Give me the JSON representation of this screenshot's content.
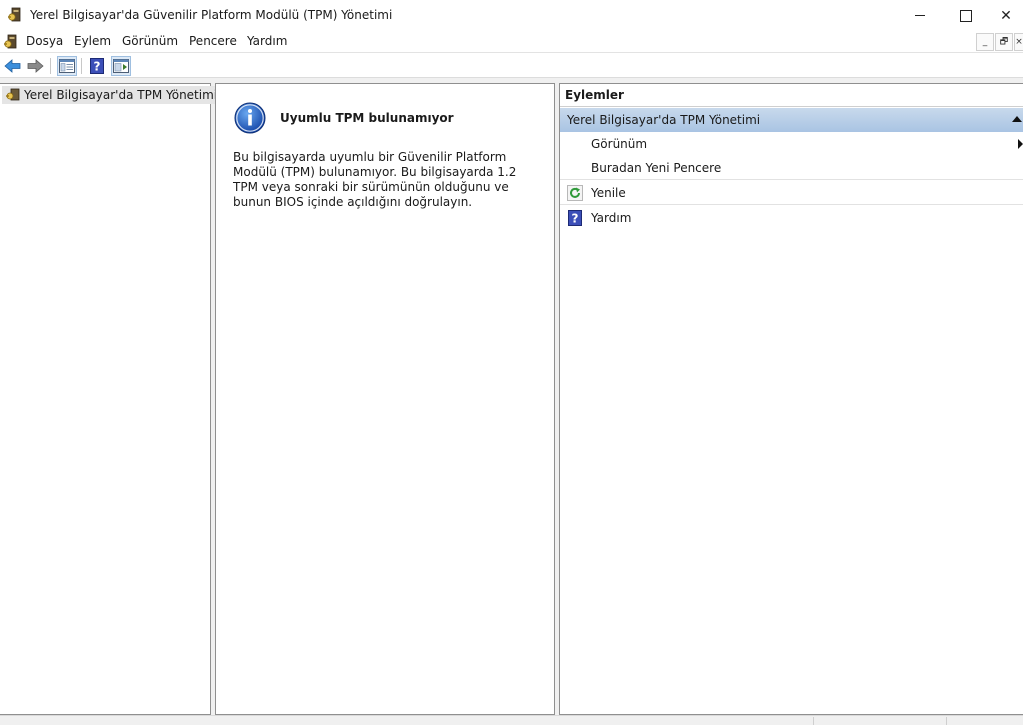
{
  "window": {
    "title": "Yerel Bilgisayar'da Güvenilir Platform Modülü (TPM) Yönetimi",
    "close_glyph": "✕"
  },
  "menubar": {
    "items": [
      "Dosya",
      "Eylem",
      "Görünüm",
      "Pencere",
      "Yardım"
    ],
    "mdi_minimize": "_",
    "mdi_restore": "🗗",
    "mdi_close": "×"
  },
  "toolbar": {
    "icons": [
      "back-arrow-icon",
      "forward-arrow-icon",
      "show-hide-console-tree-icon",
      "help-icon",
      "show-hide-action-pane-icon"
    ]
  },
  "tree": {
    "selected_item": "Yerel Bilgisayar'da TPM Yönetimi"
  },
  "result": {
    "title": "Uyumlu TPM bulunamıyor",
    "body": "Bu bilgisayarda uyumlu bir Güvenilir Platform Modülü (TPM) bulunamıyor. Bu bilgisayarda 1.2 TPM veya sonraki bir sürümünün olduğunu ve bunun BIOS içinde açıldığını doğrulayın."
  },
  "actions": {
    "header": "Eylemler",
    "section_title": "Yerel Bilgisayar'da TPM Yönetimi",
    "items": [
      "Görünüm",
      "Buradan Yeni Pencere",
      "Yenile",
      "Yardım"
    ]
  },
  "colors": {
    "selection_band": "#b7cde8",
    "tree_selection": "#e5e5e5",
    "pane_border": "#8f8f8f",
    "info_blue": "#1f5fbf"
  }
}
